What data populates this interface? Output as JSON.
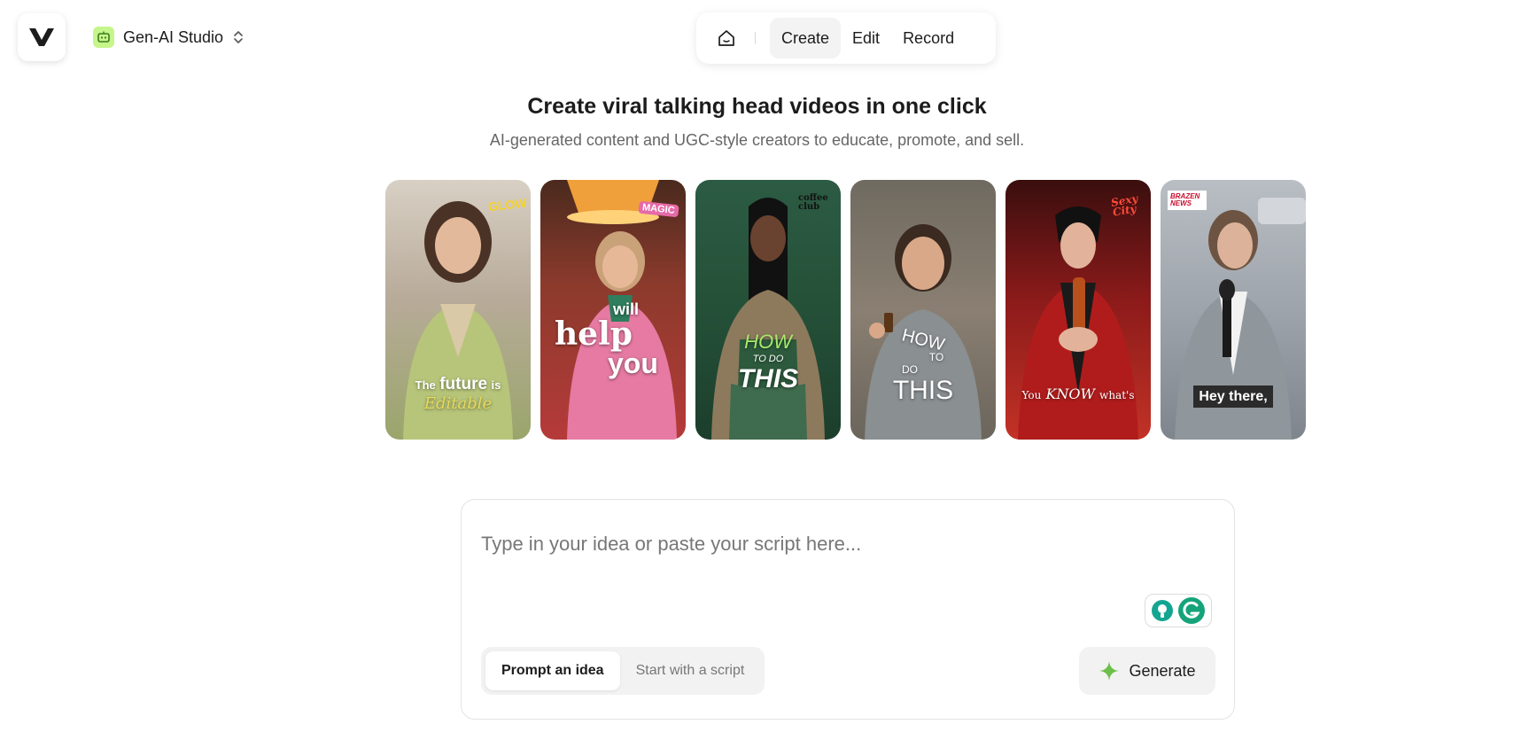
{
  "workspace": {
    "name": "Gen-AI Studio"
  },
  "nav": {
    "tabs": [
      {
        "label": "Create",
        "active": true
      },
      {
        "label": "Edit",
        "active": false
      },
      {
        "label": "Record",
        "active": false
      }
    ]
  },
  "hero": {
    "title": "Create viral talking head videos in one click",
    "subtitle": "AI-generated content and UGC-style creators to educate, promote, and sell."
  },
  "cards": [
    {
      "overlay": [
        "The",
        "future",
        "is",
        "Editable"
      ],
      "badge": "GLOW"
    },
    {
      "overlay": [
        "will",
        "help",
        "you"
      ],
      "badge": "MAGIC"
    },
    {
      "overlay": [
        "HOW",
        "TO DO",
        "THIS"
      ],
      "badge": "coffee club"
    },
    {
      "overlay": [
        "HOW",
        "TO",
        "DO",
        "THIS"
      ],
      "badge": ""
    },
    {
      "overlay": [
        "You",
        "KNOW",
        "what's"
      ],
      "badge": "Sexy City"
    },
    {
      "overlay": [
        "Hey there,"
      ],
      "badge": "BRAZEN NEWS"
    }
  ],
  "prompt": {
    "placeholder": "Type in your idea or paste your script here...",
    "modes": [
      {
        "label": "Prompt an idea",
        "active": true
      },
      {
        "label": "Start with a script",
        "active": false
      }
    ],
    "generate_label": "Generate"
  },
  "colors": {
    "accent_green": "#6cc04a",
    "workspace_badge": "#c6f58b",
    "grammarly": "#15a37a"
  }
}
